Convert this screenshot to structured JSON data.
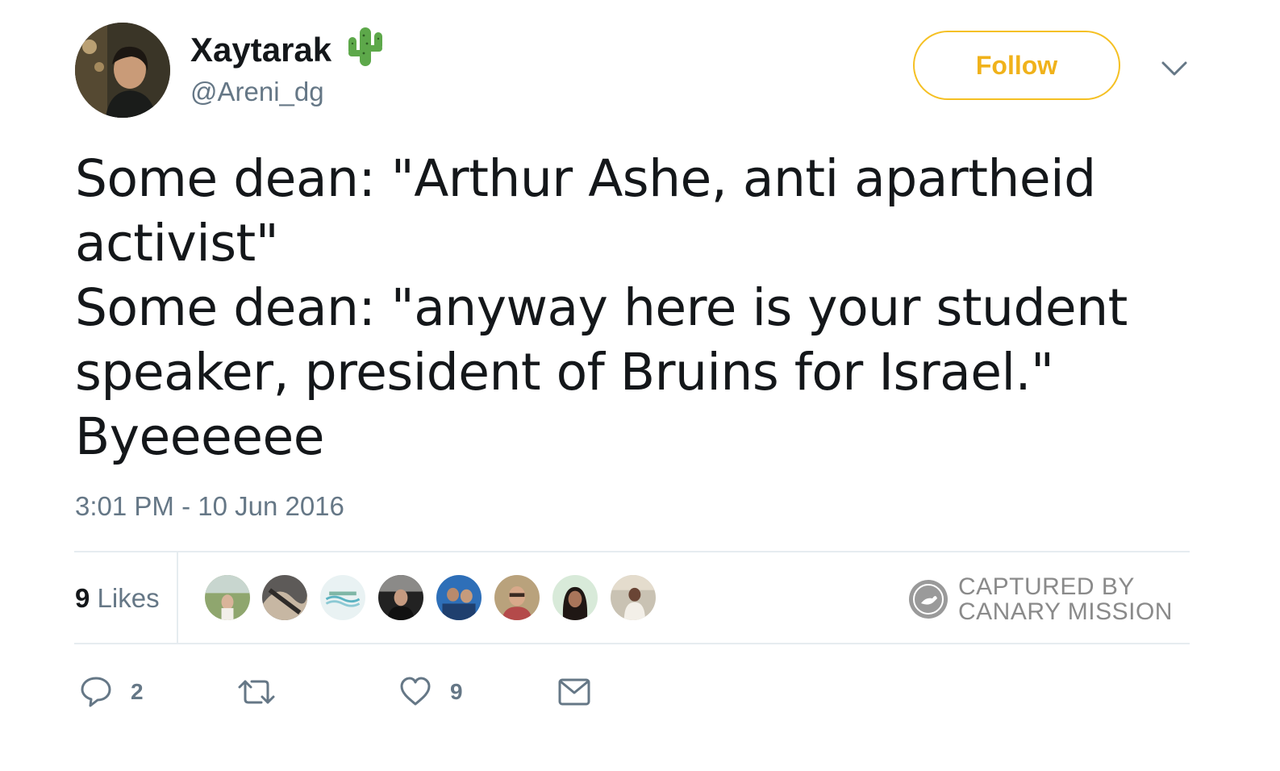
{
  "tweet": {
    "display_name": "Xaytarak",
    "name_emoji": "cactus-icon",
    "handle": "@Areni_dg",
    "follow_label": "Follow",
    "text_lines": [
      "Some dean: \"Arthur Ashe, anti apartheid",
      "activist\"",
      "Some dean: \"anyway here is your student",
      "speaker, president of Bruins for Israel.\"",
      "Byeeeeee"
    ],
    "timestamp": "3:01 PM - 10 Jun 2016"
  },
  "stats": {
    "likes_count": "9",
    "likes_label": " Likes",
    "liker_avatar_count": 8
  },
  "watermark": {
    "line1": "CAPTURED BY",
    "line2": "CANARY MISSION"
  },
  "actions": {
    "reply_count": "2",
    "retweet_count": "",
    "like_count": "9"
  },
  "colors": {
    "accent": "#f5c023",
    "text": "#14171a",
    "secondary": "#657786",
    "divider": "#e6ecf0"
  }
}
